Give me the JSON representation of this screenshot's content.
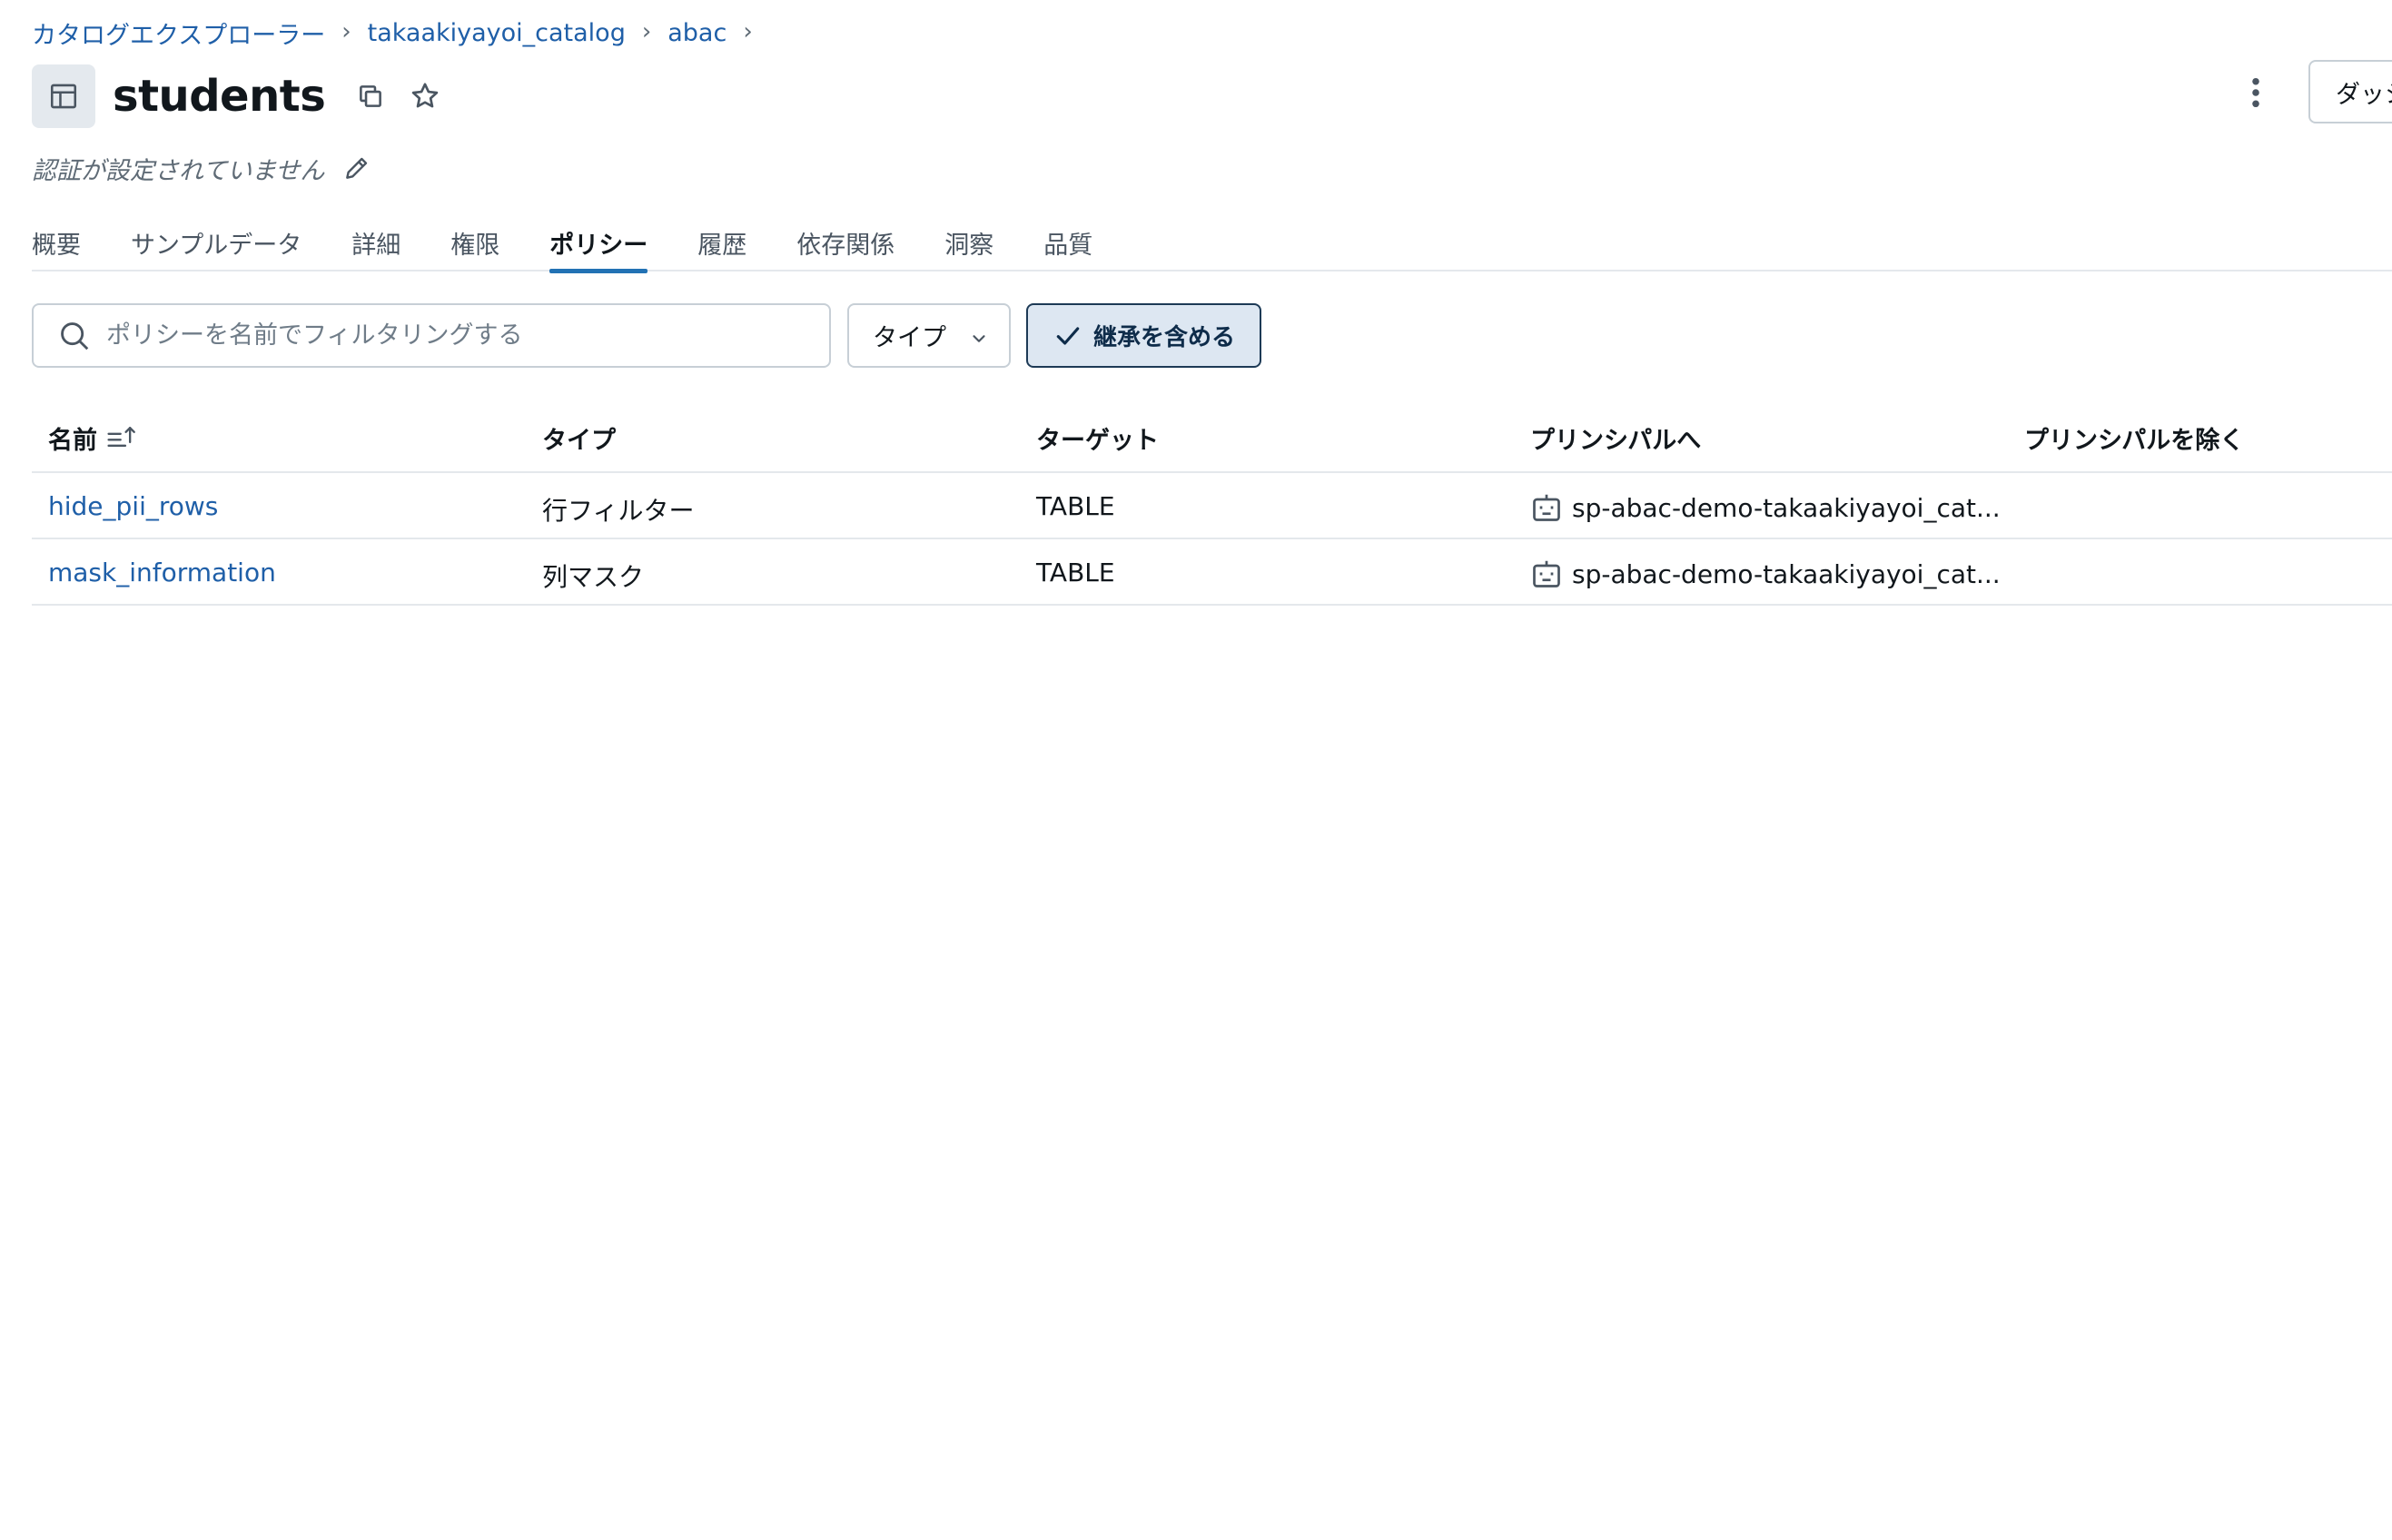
{
  "breadcrumb": {
    "items": [
      "カタログエクスプローラー",
      "takaakiyayoi_catalog",
      "abac"
    ],
    "separator": "›"
  },
  "header": {
    "title": "students",
    "icon": "table-icon",
    "copy_icon": "copy-icon",
    "favorite_icon": "star-icon",
    "kebab_icon": "kebab-menu-icon",
    "top_right_button_label": "ダッシ"
  },
  "certification": {
    "text": "認証が設定されていません",
    "edit_icon": "pencil-icon"
  },
  "tabs": {
    "items": [
      "概要",
      "サンプルデータ",
      "詳細",
      "権限",
      "ポリシー",
      "履歴",
      "依存関係",
      "洞察",
      "品質"
    ],
    "active": "ポリシー"
  },
  "filters": {
    "search_placeholder": "ポリシーを名前でフィルタリングする",
    "search_value": "",
    "type_label": "タイプ",
    "inherit_label": "継承を含める",
    "inherit_checked": true
  },
  "table": {
    "columns": [
      "名前",
      "タイプ",
      "ターゲット",
      "プリンシパルへ",
      "プリンシパルを除く"
    ],
    "sort_icon": "sort-ascending-icon",
    "rows": [
      {
        "name": "hide_pii_rows",
        "type": "行フィルター",
        "target": "TABLE",
        "principal_to": "sp-abac-demo-takaakiyayoi_cat...",
        "principal_except": ""
      },
      {
        "name": "mask_information",
        "type": "列マスク",
        "target": "TABLE",
        "principal_to": "sp-abac-demo-takaakiyayoi_cat...",
        "principal_except": ""
      }
    ],
    "principal_icon": "service-principal-robot-icon"
  },
  "colors": {
    "link": "#1f5fa8",
    "active_tab_underline": "#2272b4",
    "inherit_bg": "#dde7f2",
    "border": "#c7cfd6"
  }
}
